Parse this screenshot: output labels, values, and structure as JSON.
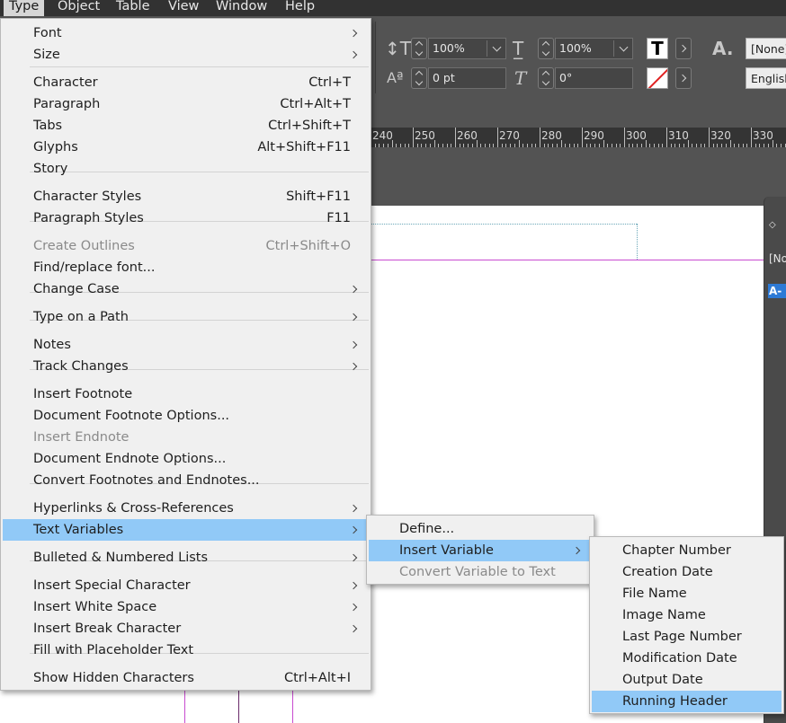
{
  "menubar": {
    "items": [
      "Type",
      "Object",
      "Table",
      "View",
      "Window",
      "Help"
    ],
    "active": "Type"
  },
  "control_panel": {
    "vertical_scale": "100%",
    "horizontal_scale": "100%",
    "baseline_shift": "0 pt",
    "skew": "0°",
    "character_style": "[None]",
    "language": "English"
  },
  "ruler": {
    "labels": [
      "240",
      "250",
      "260",
      "270",
      "280",
      "290",
      "300",
      "310",
      "320",
      "330"
    ]
  },
  "side_panel": {
    "text1": "[No",
    "selected": "A-P"
  },
  "type_menu": {
    "items": [
      {
        "label": "Font",
        "shortcut": "",
        "submenu": true,
        "disabled": false
      },
      {
        "label": "Size",
        "shortcut": "",
        "submenu": true,
        "disabled": false
      },
      {
        "label": "Character",
        "shortcut": "Ctrl+T",
        "submenu": false,
        "disabled": false
      },
      {
        "label": "Paragraph",
        "shortcut": "Ctrl+Alt+T",
        "submenu": false,
        "disabled": false
      },
      {
        "label": "Tabs",
        "shortcut": "Ctrl+Shift+T",
        "submenu": false,
        "disabled": false
      },
      {
        "label": "Glyphs",
        "shortcut": "Alt+Shift+F11",
        "submenu": false,
        "disabled": false
      },
      {
        "label": "Story",
        "shortcut": "",
        "submenu": false,
        "disabled": false
      },
      {
        "label": "Character Styles",
        "shortcut": "Shift+F11",
        "submenu": false,
        "disabled": false
      },
      {
        "label": "Paragraph Styles",
        "shortcut": "F11",
        "submenu": false,
        "disabled": false
      },
      {
        "label": "Create Outlines",
        "shortcut": "Ctrl+Shift+O",
        "submenu": false,
        "disabled": true
      },
      {
        "label": "Find/replace font...",
        "shortcut": "",
        "submenu": false,
        "disabled": false
      },
      {
        "label": "Change Case",
        "shortcut": "",
        "submenu": true,
        "disabled": false
      },
      {
        "label": "Type on a Path",
        "shortcut": "",
        "submenu": true,
        "disabled": false
      },
      {
        "label": "Notes",
        "shortcut": "",
        "submenu": true,
        "disabled": false
      },
      {
        "label": "Track Changes",
        "shortcut": "",
        "submenu": true,
        "disabled": false
      },
      {
        "label": "Insert Footnote",
        "shortcut": "",
        "submenu": false,
        "disabled": false
      },
      {
        "label": "Document Footnote Options...",
        "shortcut": "",
        "submenu": false,
        "disabled": false
      },
      {
        "label": "Insert Endnote",
        "shortcut": "",
        "submenu": false,
        "disabled": true
      },
      {
        "label": "Document Endnote Options...",
        "shortcut": "",
        "submenu": false,
        "disabled": false
      },
      {
        "label": "Convert Footnotes and Endnotes...",
        "shortcut": "",
        "submenu": false,
        "disabled": false
      },
      {
        "label": "Hyperlinks & Cross-References",
        "shortcut": "",
        "submenu": true,
        "disabled": false
      },
      {
        "label": "Text Variables",
        "shortcut": "",
        "submenu": true,
        "disabled": false,
        "highlighted": true
      },
      {
        "label": "Bulleted & Numbered Lists",
        "shortcut": "",
        "submenu": true,
        "disabled": false
      },
      {
        "label": "Insert Special Character",
        "shortcut": "",
        "submenu": true,
        "disabled": false
      },
      {
        "label": "Insert White Space",
        "shortcut": "",
        "submenu": true,
        "disabled": false
      },
      {
        "label": "Insert Break Character",
        "shortcut": "",
        "submenu": true,
        "disabled": false
      },
      {
        "label": "Fill with Placeholder Text",
        "shortcut": "",
        "submenu": false,
        "disabled": false
      },
      {
        "label": "Show Hidden Characters",
        "shortcut": "Ctrl+Alt+I",
        "submenu": false,
        "disabled": false
      }
    ]
  },
  "text_variables_menu": {
    "items": [
      {
        "label": "Define...",
        "submenu": false,
        "disabled": false
      },
      {
        "label": "Insert Variable",
        "submenu": true,
        "disabled": false,
        "highlighted": true
      },
      {
        "label": "Convert Variable to Text",
        "submenu": false,
        "disabled": true
      }
    ]
  },
  "insert_variable_menu": {
    "items": [
      {
        "label": "Chapter Number",
        "highlighted": false
      },
      {
        "label": "Creation Date",
        "highlighted": false
      },
      {
        "label": "File Name",
        "highlighted": false
      },
      {
        "label": "Image Name",
        "highlighted": false
      },
      {
        "label": "Last Page Number",
        "highlighted": false
      },
      {
        "label": "Modification Date",
        "highlighted": false
      },
      {
        "label": "Output Date",
        "highlighted": false
      },
      {
        "label": "Running Header",
        "highlighted": true
      }
    ]
  },
  "colors": {
    "highlight": "#91c9f7",
    "menu_bg": "#f0f0f0",
    "app_bg": "#535353",
    "margin_guide": "#c84bd0"
  }
}
